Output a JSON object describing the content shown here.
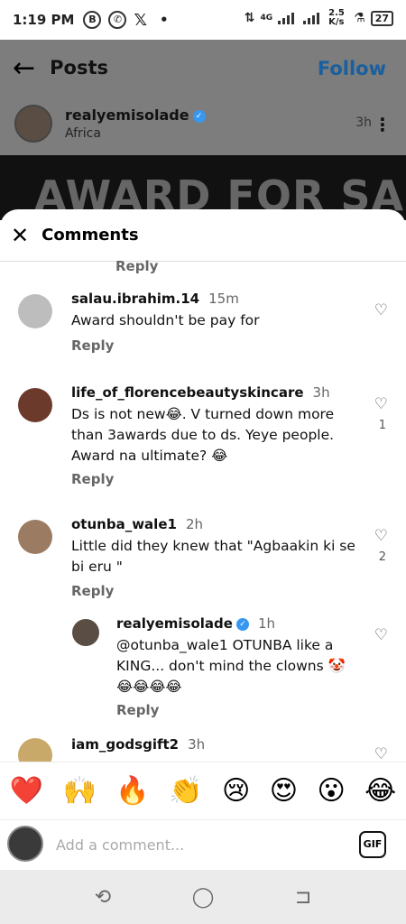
{
  "status": {
    "time": "1:19 PM",
    "speed": "2.5 K/s",
    "battery": "27",
    "network": "4G",
    "icons": [
      "b-icon",
      "whatsapp-icon",
      "x-icon"
    ]
  },
  "post": {
    "title": "Posts",
    "follow_label": "Follow",
    "author": "realyemisolade",
    "location": "Africa",
    "time": "3h",
    "banner_text": "AWARD FOR SALE"
  },
  "comments_sheet": {
    "title": "Comments",
    "top_reply": "Reply",
    "items": [
      {
        "user": "salau.ibrahim.14",
        "time": "15m",
        "text": "Award shouldn't be pay for",
        "reply": "Reply",
        "likes": ""
      },
      {
        "user": "life_of_florencebeautyskincare",
        "time": "3h",
        "text": "Ds is not new😂. V turned down more than 3awards due to ds. Yeye people. Award na ultimate? 😂",
        "reply": "Reply",
        "likes": "1"
      },
      {
        "user": "otunba_wale1",
        "time": "2h",
        "text": "Little did they knew that \"Agbaakin ki se bi eru \"",
        "reply": "Reply",
        "likes": "2"
      },
      {
        "user": "realyemisolade",
        "time": "1h",
        "text": "@otunba_wale1 OTUNBA like a KING... don't mind the clowns 🤡 😂😂😂😂",
        "reply": "Reply",
        "likes": ""
      },
      {
        "user": "iam_godsgift2",
        "time": "3h",
        "text": "",
        "reply": "",
        "likes": ""
      }
    ]
  },
  "emoji_bar": [
    "❤️",
    "🙌",
    "🔥",
    "👏",
    "😢",
    "😍",
    "😮",
    "😂"
  ],
  "composer": {
    "placeholder": "Add a comment...",
    "gif_label": "GIF"
  },
  "navbar": {
    "recent": "⟲",
    "home": "◯",
    "back": "⊐"
  }
}
